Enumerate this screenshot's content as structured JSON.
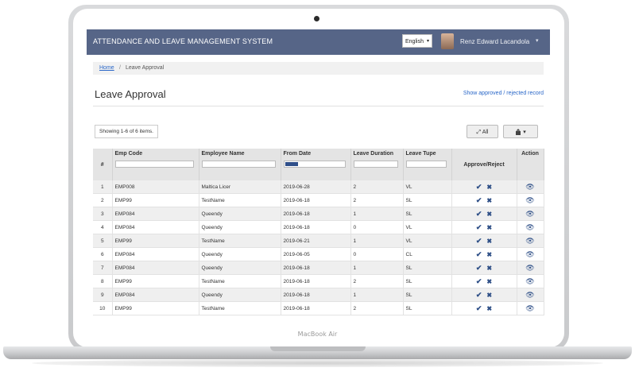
{
  "device": {
    "brand_label": "MacBook Air"
  },
  "header": {
    "app_title": "ATTENDANCE AND LEAVE MANAGEMENT SYSTEM",
    "language": "English",
    "user_name": "Renz Edward Lacandola"
  },
  "breadcrumb": {
    "home": "Home",
    "separator": "/",
    "current": "Leave Approval"
  },
  "page": {
    "title": "Leave Approval",
    "record_link": "Show approved / rejected record",
    "summary": "Showing 1-6 of 6 items.",
    "all_button": "All"
  },
  "icons": {
    "expand": "⤢",
    "export": "export-icon",
    "approve": "✔",
    "reject": "✖",
    "view": "👁",
    "caret": "▾"
  },
  "table": {
    "headers": {
      "index": "#",
      "emp_code": "Emp Code",
      "employee_name": "Employee Name",
      "from_date": "From Date",
      "leave_duration": "Leave Duration",
      "leave_type": "Leave Tupe",
      "approve_reject": "Approve/Reject",
      "action": "Action"
    },
    "rows": [
      {
        "n": "1",
        "code": "EMP008",
        "name": "Maltica Licer",
        "date": "2019-06-28",
        "duration": "2",
        "type": "VL"
      },
      {
        "n": "2",
        "code": "EMP99",
        "name": "TestName",
        "date": "2019-06-18",
        "duration": "2",
        "type": "SL"
      },
      {
        "n": "3",
        "code": "EMP084",
        "name": "Queendy",
        "date": "2019-06-18",
        "duration": "1",
        "type": "SL"
      },
      {
        "n": "4",
        "code": "EMP084",
        "name": "Queendy",
        "date": "2019-06-18",
        "duration": "0",
        "type": "VL"
      },
      {
        "n": "5",
        "code": "EMP99",
        "name": "TestName",
        "date": "2019-06-21",
        "duration": "1",
        "type": "VL"
      },
      {
        "n": "6",
        "code": "EMP084",
        "name": "Queendy",
        "date": "2019-06-05",
        "duration": "0",
        "type": "CL"
      },
      {
        "n": "7",
        "code": "EMP084",
        "name": "Queendy",
        "date": "2019-06-18",
        "duration": "1",
        "type": "SL"
      },
      {
        "n": "8",
        "code": "EMP99",
        "name": "TestName",
        "date": "2019-06-18",
        "duration": "2",
        "type": "SL"
      },
      {
        "n": "9",
        "code": "EMP084",
        "name": "Queendy",
        "date": "2019-06-18",
        "duration": "1",
        "type": "SL"
      },
      {
        "n": "10",
        "code": "EMP99",
        "name": "TestName",
        "date": "2019-06-18",
        "duration": "2",
        "type": "SL"
      }
    ]
  }
}
